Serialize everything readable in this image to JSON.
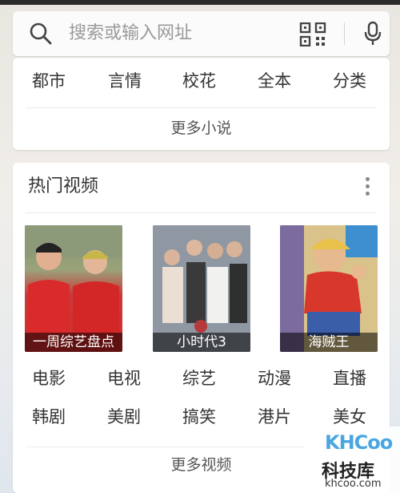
{
  "search": {
    "placeholder": "搜索或输入网址"
  },
  "novel": {
    "categories": [
      "都市",
      "言情",
      "校花",
      "全本",
      "分类"
    ],
    "more_label": "更多小说"
  },
  "video": {
    "title": "热门视频",
    "items": [
      {
        "caption": "一周综艺盘点"
      },
      {
        "caption": "小时代3"
      },
      {
        "caption": "海贼王"
      }
    ],
    "row1": [
      "电影",
      "电视",
      "综艺",
      "动漫",
      "直播"
    ],
    "row2": [
      "韩剧",
      "美剧",
      "搞笑",
      "港片",
      "美女"
    ],
    "more_label": "更多视频"
  },
  "watermark": {
    "logo": "KHCoo",
    "name": "科技库",
    "domain": "khcoo.com"
  }
}
